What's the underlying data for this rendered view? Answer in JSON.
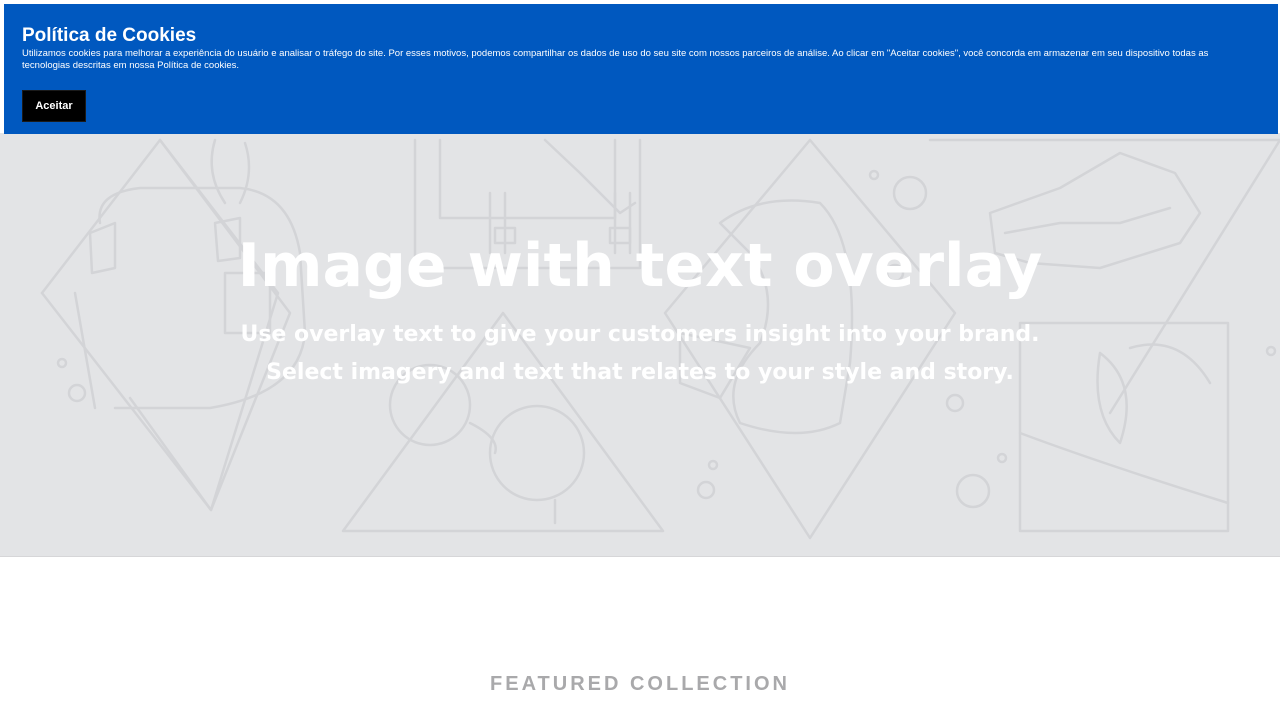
{
  "cookie_banner": {
    "title": "Política de Cookies",
    "text": "Utilizamos cookies para melhorar a experiência do usuário e analisar o tráfego do site. Por esses motivos, podemos compartilhar os dados de uso do seu site com nossos parceiros de análise. Ao clicar em \"Aceitar cookies\", você concorda em armazenar em seu dispositivo todas as tecnologias descritas em nossa Política de cookies.",
    "accept_label": "Aceitar",
    "background_color": "#0058bf",
    "button_color": "#000000"
  },
  "hero": {
    "title": "Image with text overlay",
    "subtitle_line1": "Use overlay text to give your customers insight into your brand.",
    "subtitle_line2": "Select imagery and text that relates to your style and story.",
    "background_color": "#e3e4e6"
  },
  "featured": {
    "title": "FEATURED COLLECTION"
  }
}
